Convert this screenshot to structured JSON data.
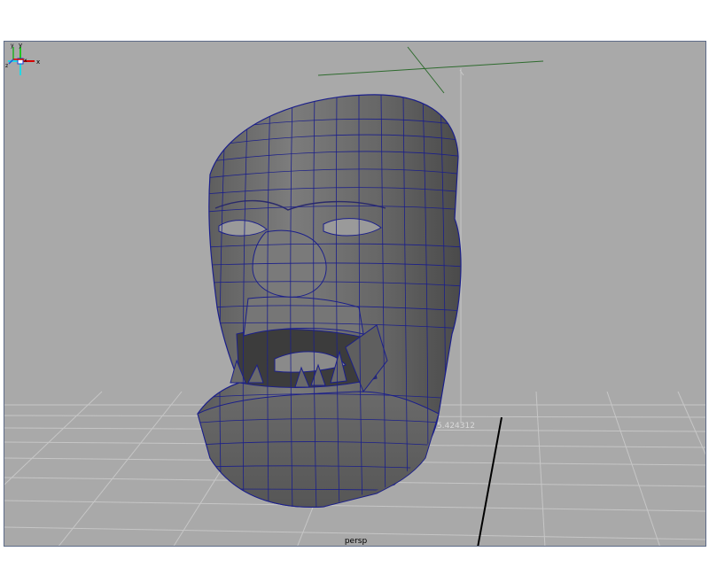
{
  "viewport": {
    "camera_name": "persp",
    "heads_up_value": "5.424312",
    "background_color": "#a9a9a9",
    "grid_color": "#c6c6c6",
    "axis_line_color": "#000000",
    "origin_marker_color": "#2e6b2e",
    "wireframe_color": "#1b1f8a",
    "mesh_base_color": "#6f6f6f"
  },
  "view_cube": {
    "icon": "view-axis-gizmo-icon",
    "labels": {
      "y": "y",
      "x": "x"
    },
    "colors": {
      "x": "#d40000",
      "y": "#1fc41f",
      "z": "#22d8e6",
      "center": "#ffffff"
    }
  },
  "axis_indicator": {
    "icon": "world-axis-icon",
    "labels": {
      "y": "y",
      "x": "x",
      "z": "z"
    },
    "colors": {
      "x": "#d40000",
      "y": "#22b022",
      "z": "#2255dd"
    }
  },
  "model": {
    "icon": "head-mesh-icon"
  }
}
